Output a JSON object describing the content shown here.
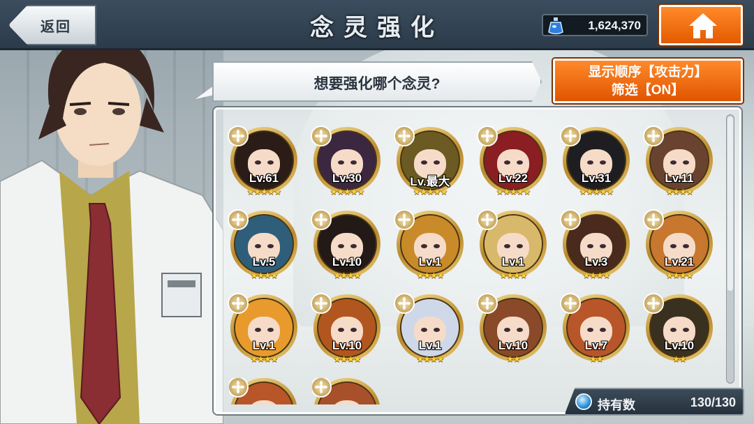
{
  "header": {
    "back_label": "返回",
    "title": "念灵强化",
    "currency_amount": "1,624,370",
    "currency_icon": "blue-potion-icon",
    "home_icon": "home-icon"
  },
  "speech": {
    "text": "想要强化哪个念灵?"
  },
  "sort_button": {
    "line1": "显示顺序【攻击力】",
    "line2": "筛选【ON】"
  },
  "cards": [
    {
      "level": "Lv.61",
      "stars": "★★★★★",
      "hair": "#2b1c17"
    },
    {
      "level": "Lv.30",
      "stars": "★★★★★",
      "hair": "#3b2740"
    },
    {
      "level": "Lv.最大",
      "stars": "★★★★★",
      "hair": "#6b5a22"
    },
    {
      "level": "Lv.22",
      "stars": "★★★★★",
      "hair": "#8a1e22"
    },
    {
      "level": "Lv.31",
      "stars": "★★★★★",
      "hair": "#1e1e22"
    },
    {
      "level": "Lv.11",
      "stars": "★★★★",
      "hair": "#6a4330"
    },
    {
      "level": "Lv.5",
      "stars": "★★★★",
      "hair": "#2f5e7a"
    },
    {
      "level": "Lv.10",
      "stars": "★★★★",
      "hair": "#231a18"
    },
    {
      "level": "Lv.1",
      "stars": "★★★★",
      "hair": "#c98a2a"
    },
    {
      "level": "Lv.1",
      "stars": "★★★★",
      "hair": "#d8b86a"
    },
    {
      "level": "Lv.3",
      "stars": "★★★★",
      "hair": "#4a2a1c"
    },
    {
      "level": "Lv.21",
      "stars": "★★★★",
      "hair": "#c7772e"
    },
    {
      "level": "Lv.1",
      "stars": "★★★★",
      "hair": "#e89a2c"
    },
    {
      "level": "Lv.10",
      "stars": "★★★★",
      "hair": "#b2561f"
    },
    {
      "level": "Lv.1",
      "stars": "★★★★",
      "hair": "#cfd8e8"
    },
    {
      "level": "Lv.10",
      "stars": "★★",
      "hair": "#8a4a2a"
    },
    {
      "level": "Lv.7",
      "stars": "★★",
      "hair": "#b8562a"
    },
    {
      "level": "Lv.10",
      "stars": "★★",
      "hair": "#3a3020"
    },
    {
      "level": "",
      "stars": "",
      "hair": "#b8562a"
    },
    {
      "level": "",
      "stars": "",
      "hair": "#a8502a"
    }
  ],
  "owned": {
    "label": "持有数",
    "value": "130/130"
  }
}
